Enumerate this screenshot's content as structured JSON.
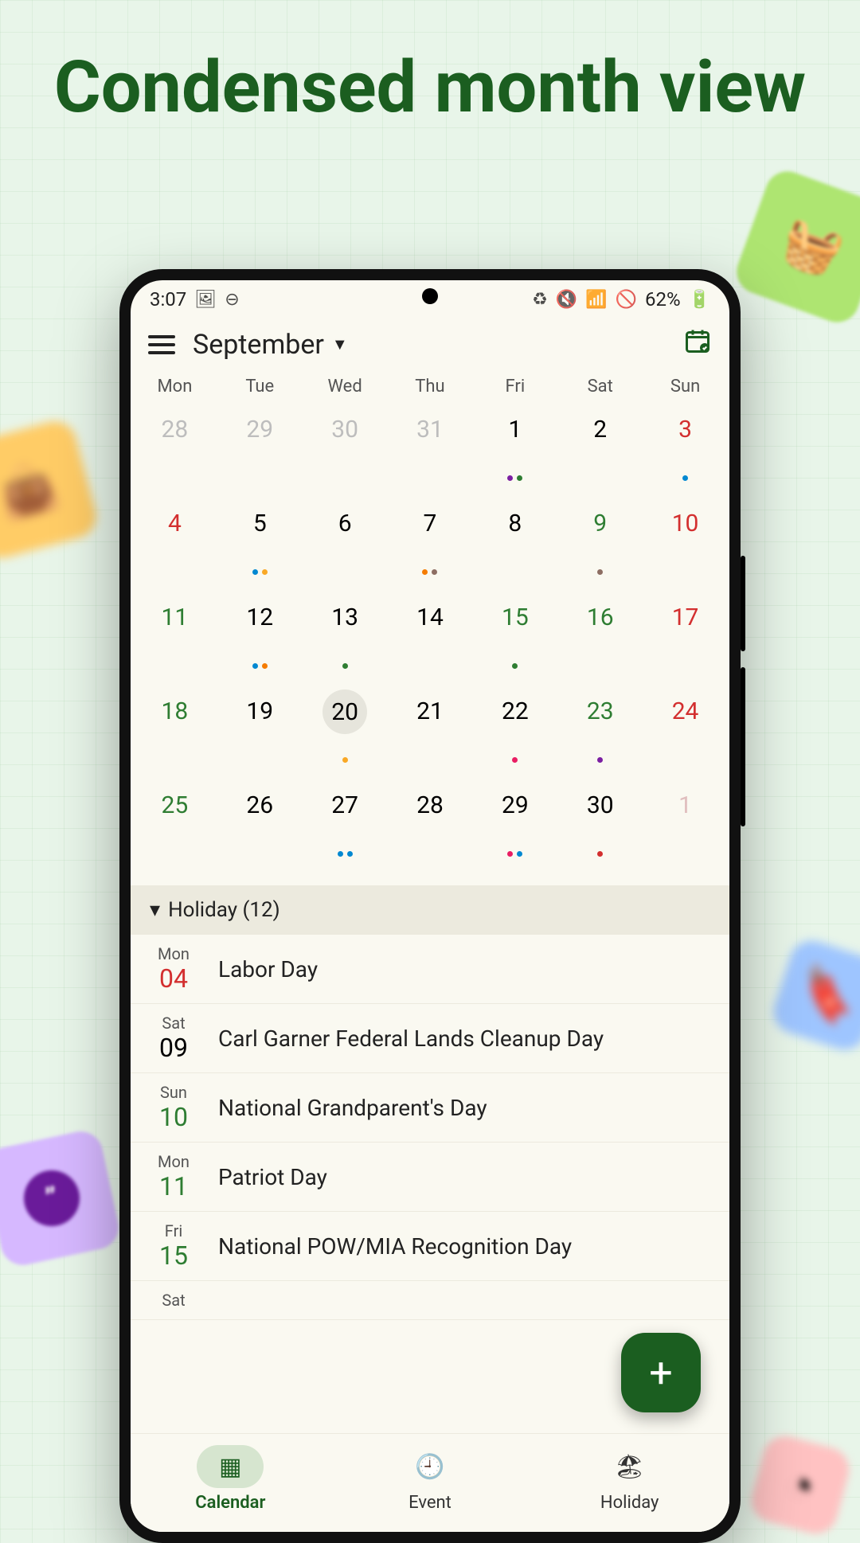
{
  "headline": "Condensed month view",
  "status": {
    "time": "3:07",
    "battery": "62%"
  },
  "header": {
    "month": "September"
  },
  "weekdays": [
    "Mon",
    "Tue",
    "Wed",
    "Thu",
    "Fri",
    "Sat",
    "Sun"
  ],
  "days": [
    {
      "n": "28",
      "cls": "c-dim"
    },
    {
      "n": "29",
      "cls": "c-dim"
    },
    {
      "n": "30",
      "cls": "c-dim"
    },
    {
      "n": "31",
      "cls": "c-dim"
    },
    {
      "n": "1",
      "dots": [
        "#7b1fa2",
        "#2e7d32"
      ]
    },
    {
      "n": "2"
    },
    {
      "n": "3",
      "cls": "c-red",
      "dots": [
        "#0288d1"
      ]
    },
    {
      "n": "4",
      "cls": "c-red"
    },
    {
      "n": "5",
      "dots": [
        "#0288d1",
        "#f9a825"
      ]
    },
    {
      "n": "6"
    },
    {
      "n": "7",
      "dots": [
        "#f57c00",
        "#8d6e63"
      ]
    },
    {
      "n": "8"
    },
    {
      "n": "9",
      "cls": "c-green",
      "dots": [
        "#8d6e63"
      ]
    },
    {
      "n": "10",
      "cls": "c-red"
    },
    {
      "n": "11",
      "cls": "c-green"
    },
    {
      "n": "12",
      "dots": [
        "#0288d1",
        "#f57c00"
      ]
    },
    {
      "n": "13",
      "dots": [
        "#2e7d32"
      ]
    },
    {
      "n": "14"
    },
    {
      "n": "15",
      "cls": "c-green",
      "dots": [
        "#2e7d32"
      ]
    },
    {
      "n": "16",
      "cls": "c-green"
    },
    {
      "n": "17",
      "cls": "c-red"
    },
    {
      "n": "18",
      "cls": "c-green"
    },
    {
      "n": "19"
    },
    {
      "n": "20",
      "today": true,
      "dots": [
        "#f9a825"
      ]
    },
    {
      "n": "21"
    },
    {
      "n": "22",
      "dots": [
        "#e91e63"
      ]
    },
    {
      "n": "23",
      "cls": "c-green",
      "dots": [
        "#7b1fa2"
      ]
    },
    {
      "n": "24",
      "cls": "c-red"
    },
    {
      "n": "25",
      "cls": "c-green"
    },
    {
      "n": "26"
    },
    {
      "n": "27",
      "dots": [
        "#0288d1",
        "#0288d1"
      ]
    },
    {
      "n": "28"
    },
    {
      "n": "29",
      "dots": [
        "#e91e63",
        "#0288d1"
      ]
    },
    {
      "n": "30",
      "dots": [
        "#d32f2f"
      ]
    },
    {
      "n": "1",
      "cls": "c-dimred"
    }
  ],
  "section": {
    "title": "Holiday (12)"
  },
  "events": [
    {
      "dow": "Mon",
      "num": "04",
      "numCls": "c-red",
      "title": "Labor Day"
    },
    {
      "dow": "Sat",
      "num": "09",
      "numCls": "",
      "title": "Carl Garner Federal Lands Cleanup Day"
    },
    {
      "dow": "Sun",
      "num": "10",
      "numCls": "c-green",
      "title": "National Grandparent's Day"
    },
    {
      "dow": "Mon",
      "num": "11",
      "numCls": "c-green",
      "title": "Patriot Day"
    },
    {
      "dow": "Fri",
      "num": "15",
      "numCls": "c-green",
      "title": "National POW/MIA Recognition Day"
    },
    {
      "dow": "Sat",
      "num": "",
      "numCls": "",
      "title": ""
    }
  ],
  "nav": {
    "calendar": "Calendar",
    "event": "Event",
    "holiday": "Holiday"
  }
}
